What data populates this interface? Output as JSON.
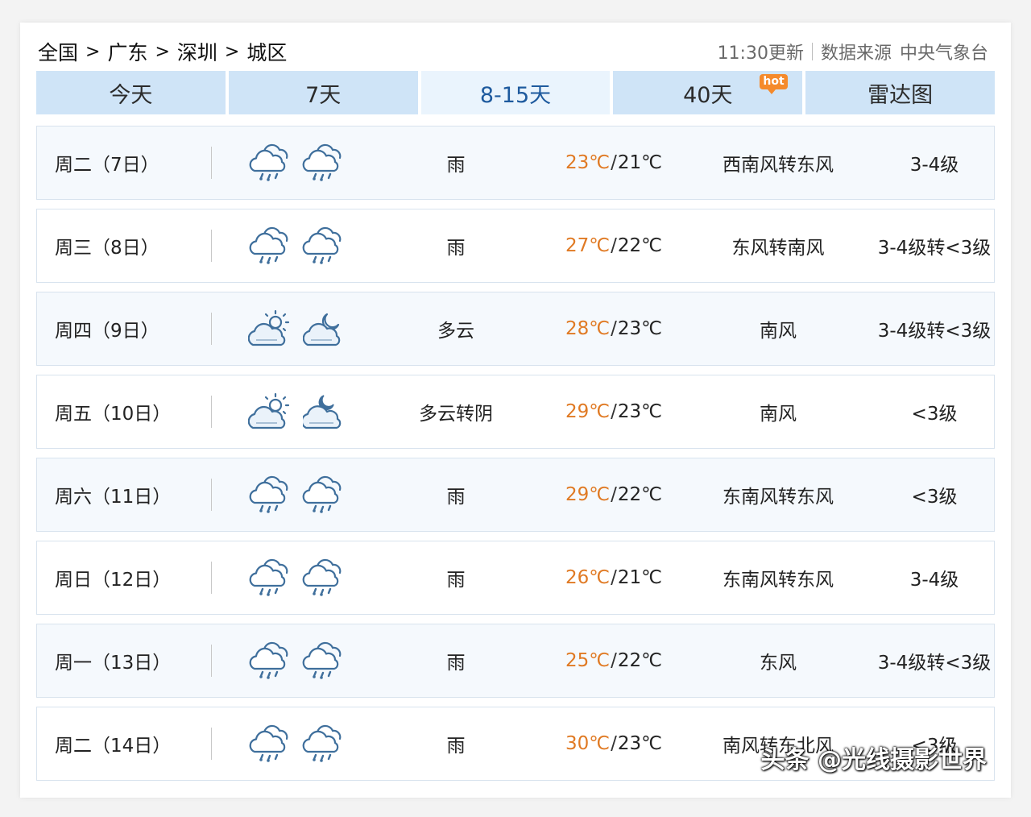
{
  "breadcrumb": [
    "全国",
    "广东",
    "深圳",
    "城区"
  ],
  "breadcrumb_sep": ">",
  "update_time": "11:30更新",
  "source_label": "数据来源",
  "source_name": "中央气象台",
  "tabs": [
    {
      "label": "今天",
      "active": false
    },
    {
      "label": "7天",
      "active": false
    },
    {
      "label": "8-15天",
      "active": true
    },
    {
      "label": "40天",
      "active": false,
      "badge": "hot"
    },
    {
      "label": "雷达图",
      "active": false
    }
  ],
  "temp_unit": "℃",
  "forecast": [
    {
      "day": "周二（7日）",
      "icon_day": "rain-icon",
      "icon_night": "rain-icon",
      "desc": "雨",
      "high": "23",
      "low": "21",
      "wind": "西南风转东风",
      "level": "3-4级"
    },
    {
      "day": "周三（8日）",
      "icon_day": "rain-icon",
      "icon_night": "rain-icon",
      "desc": "雨",
      "high": "27",
      "low": "22",
      "wind": "东风转南风",
      "level": "3-4级转<3级"
    },
    {
      "day": "周四（9日）",
      "icon_day": "partly-cloudy-sun-icon",
      "icon_night": "partly-cloudy-moon-icon",
      "desc": "多云",
      "high": "28",
      "low": "23",
      "wind": "南风",
      "level": "3-4级转<3级"
    },
    {
      "day": "周五（10日）",
      "icon_day": "partly-cloudy-sun-icon",
      "icon_night": "overcast-moon-icon",
      "desc": "多云转阴",
      "high": "29",
      "low": "23",
      "wind": "南风",
      "level": "<3级"
    },
    {
      "day": "周六（11日）",
      "icon_day": "rain-icon",
      "icon_night": "rain-icon",
      "desc": "雨",
      "high": "29",
      "low": "22",
      "wind": "东南风转东风",
      "level": "<3级"
    },
    {
      "day": "周日（12日）",
      "icon_day": "rain-icon",
      "icon_night": "rain-icon",
      "desc": "雨",
      "high": "26",
      "low": "21",
      "wind": "东南风转东风",
      "level": "3-4级"
    },
    {
      "day": "周一（13日）",
      "icon_day": "rain-icon",
      "icon_night": "rain-icon",
      "desc": "雨",
      "high": "25",
      "low": "22",
      "wind": "东风",
      "level": "3-4级转<3级"
    },
    {
      "day": "周二（14日）",
      "icon_day": "rain-icon",
      "icon_night": "rain-icon",
      "desc": "雨",
      "high": "30",
      "low": "23",
      "wind": "南风转东北风",
      "level": "<3级"
    }
  ],
  "watermark": "头条 @光线摄影世界",
  "colors": {
    "tab_bg": "#cfe4f7",
    "tab_active_bg": "#eaf4fd",
    "tab_active_text": "#1e5a9e",
    "high_temp": "#e07a24",
    "hot_badge": "#f58a2b",
    "icon_stroke": "#3f6f9c"
  }
}
